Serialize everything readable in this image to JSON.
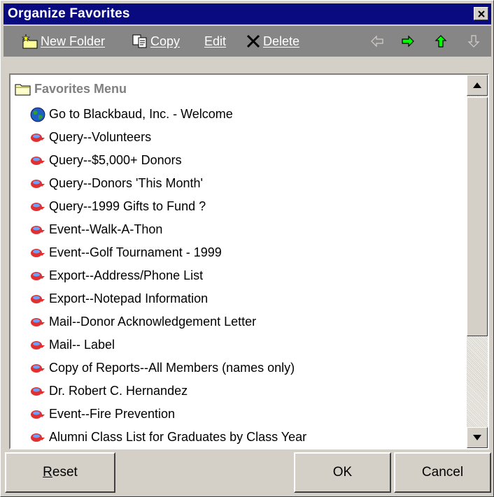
{
  "window": {
    "title": "Organize Favorites"
  },
  "toolbar": {
    "new_folder": "New Folder",
    "copy": "Copy",
    "edit": "Edit",
    "delete": "Delete",
    "icons": [
      "new-folder-icon",
      "copy-icon",
      "delete-icon",
      "arrow-left-icon",
      "arrow-right-icon",
      "arrow-up-icon",
      "arrow-down-icon"
    ]
  },
  "list": {
    "folder": "Favorites Menu",
    "items": [
      "Go to Blackbaud, Inc. - Welcome",
      "Query--Volunteers",
      "Query--$5,000+ Donors",
      "Query--Donors 'This Month'",
      "Query--1999 Gifts to Fund ?",
      "Event--Walk-A-Thon",
      "Event--Golf Tournament - 1999",
      "Export--Address/Phone List",
      "Export--Notepad Information",
      "Mail--Donor Acknowledgement Letter",
      "Mail-- Label",
      "Copy of Reports--All Members (names only)",
      "Dr. Robert C. Hernandez",
      "Event--Fire Prevention",
      "Alumni Class List for Graduates by Class Year"
    ]
  },
  "buttons": {
    "reset": "Reset",
    "ok": "OK",
    "cancel": "Cancel"
  },
  "colors": {
    "titlebar": "#0a0a80",
    "toolbar": "#868686",
    "arrow_active": "#00ff00",
    "face": "#d4d0c8"
  }
}
